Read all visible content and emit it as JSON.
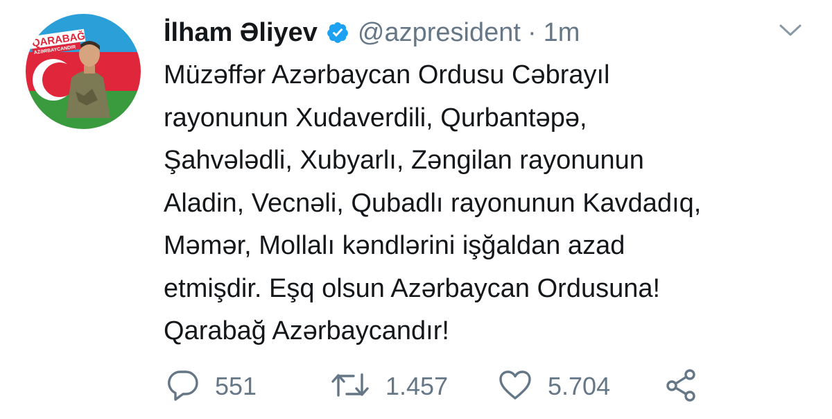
{
  "tweet": {
    "avatar": {
      "badge_line1": "QARABAĞ",
      "badge_line2": "AZƏRBAYCANDIR"
    },
    "display_name": "İlham Əliyev",
    "handle": "@azpresident",
    "separator": "·",
    "time": "1m",
    "text_lines": [
      "Müzəffər Azərbaycan Ordusu Cəbrayıl",
      "rayonunun Xudaverdili, Qurbantəpə,",
      "Şahvələdli, Xubyarlı, Zəngilan rayonunun",
      "Aladin, Vecnəli, Qubadlı rayonunun Kavdadıq,",
      "Məmər, Mollalı kəndlərini işğaldan azad",
      "etmişdir. Eşq olsun Azərbaycan Ordusuna!",
      "Qarabağ Azərbaycandır!"
    ],
    "actions": {
      "reply_count": "551",
      "retweet_count": "1.457",
      "like_count": "5.704"
    }
  },
  "colors": {
    "text": "#14171a",
    "secondary": "#657786",
    "verified": "#1da1f2"
  },
  "icons": [
    "verified-badge-icon",
    "chevron-down-icon",
    "reply-icon",
    "retweet-icon",
    "like-icon",
    "share-icon"
  ]
}
